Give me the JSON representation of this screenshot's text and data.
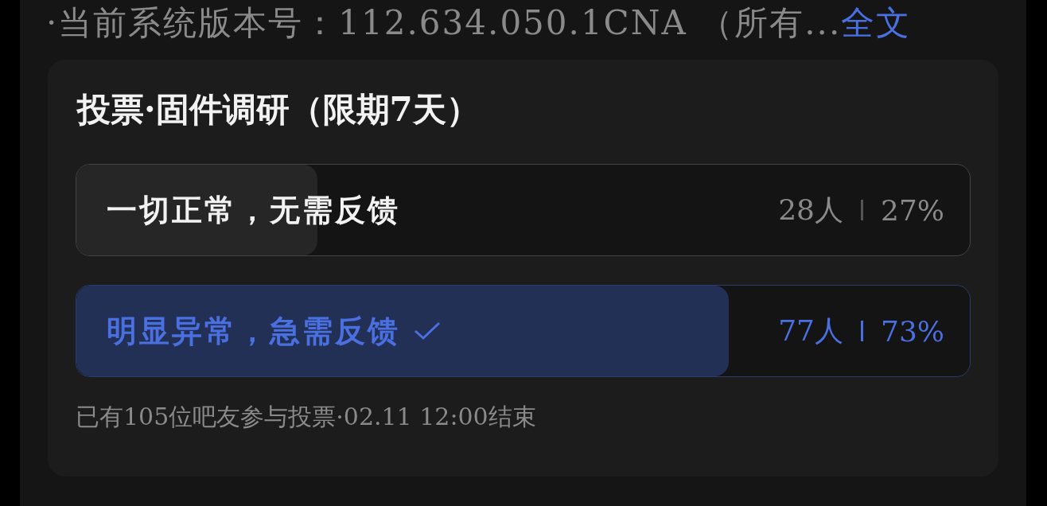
{
  "post": {
    "text": "·当前系统版本号：112.634.050.1CNA （所有...",
    "link": "全文"
  },
  "poll": {
    "title": "投票·固件调研（限期7天）",
    "options": [
      {
        "label": "一切正常，无需反馈",
        "count": "28人",
        "percent": "27%",
        "level": 0.27,
        "selected": false
      },
      {
        "label": "明显异常，急需反馈",
        "count": "77人",
        "percent": "73%",
        "level": 0.73,
        "selected": true
      }
    ],
    "footer": "已有105位吧友参与投票·02.11 12:00结束"
  }
}
